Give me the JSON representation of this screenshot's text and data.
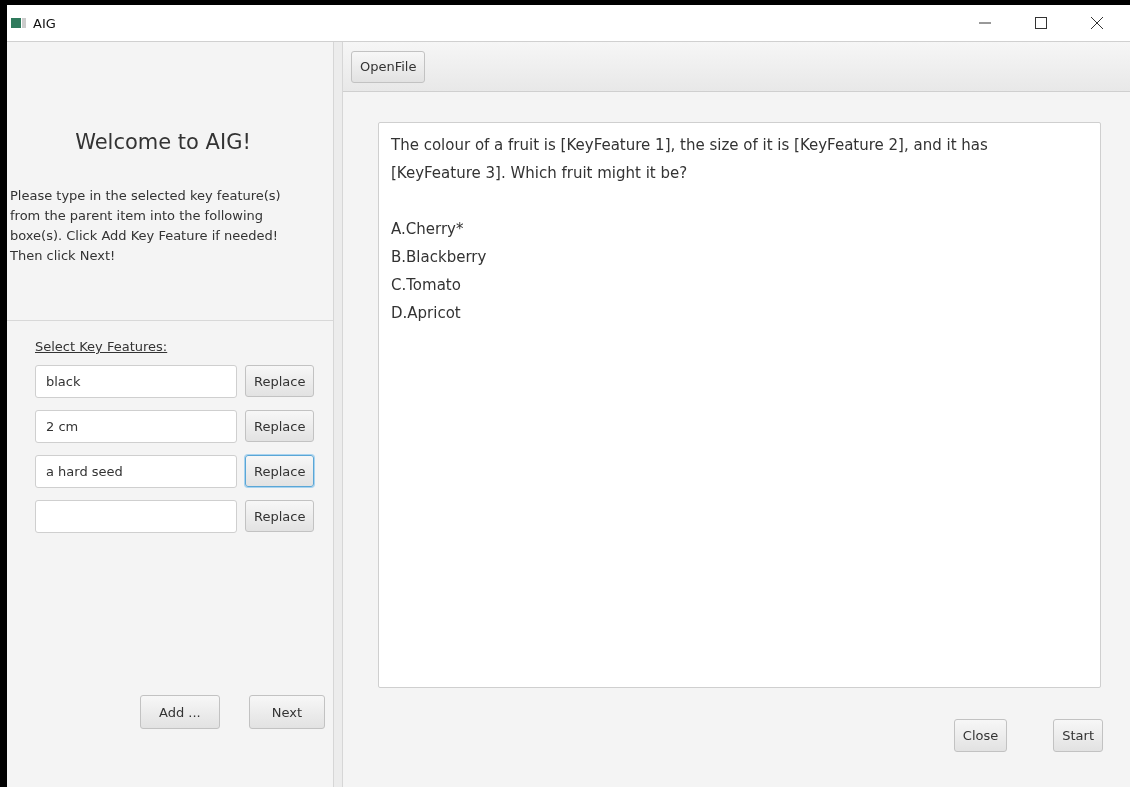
{
  "window": {
    "title": "AIG"
  },
  "left_panel": {
    "heading": "Welcome to AIG!",
    "instructions": "Please type in the selected key feature(s) from the parent item into the following boxe(s). Click Add Key Feature if needed! Then click Next!",
    "section_label": "Select Key Features:",
    "key_features": [
      {
        "value": "black",
        "button": "Replace",
        "focused": false
      },
      {
        "value": "2 cm",
        "button": "Replace",
        "focused": false
      },
      {
        "value": "a hard seed",
        "button": "Replace",
        "focused": true
      },
      {
        "button": "Replace",
        "focused": false
      }
    ],
    "buttons": [
      "Add ...",
      "Next"
    ]
  },
  "toolbar": {
    "buttons": [
      "OpenFile"
    ]
  },
  "editor": {
    "question": "The colour of a fruit is [KeyFeature 1], the size of it is [KeyFeature 2], and it has [KeyFeature 3]. Which fruit might it be?",
    "options": [
      "A.Cherry*",
      "B.Blackberry",
      "C.Tomato",
      "D.Apricot"
    ]
  },
  "footer_buttons": [
    "Close",
    "Start"
  ]
}
